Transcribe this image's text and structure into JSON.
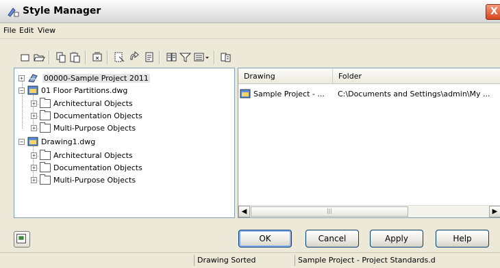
{
  "window": {
    "title": "Style Manager",
    "close_glyph": "X"
  },
  "menu": [
    "File",
    "Edit",
    "View"
  ],
  "toolbar_icons": [
    "new-icon",
    "open-icon",
    "copy-icon",
    "paste-icon",
    "purge-icon",
    "edit-style-icon",
    "rename-icon",
    "properties-icon",
    "toggle-view-icon",
    "filter-icon",
    "view-options-icon",
    "sort-icon"
  ],
  "tree": {
    "root": "00000-Sample Project 2011",
    "drawings": [
      {
        "name": "01 Floor Partitions.dwg",
        "children": [
          "Architectural Objects",
          "Documentation Objects",
          "Multi-Purpose Objects"
        ]
      },
      {
        "name": "Drawing1.dwg",
        "children": [
          "Architectural Objects",
          "Documentation Objects",
          "Multi-Purpose Objects"
        ]
      }
    ]
  },
  "list": {
    "columns": [
      "Drawing",
      "Folder"
    ],
    "rows": [
      {
        "drawing": "Sample Project - ...",
        "folder": "C:\\Documents and Settings\\admin\\My ..."
      }
    ]
  },
  "buttons": {
    "ok": "OK",
    "cancel": "Cancel",
    "apply": "Apply",
    "help": "Help"
  },
  "status": {
    "cell1": "Drawing Sorted",
    "cell2": "Sample Project - Project Standards.d"
  },
  "colors": {
    "accent": "#003c74",
    "close": "#d8451f",
    "list_border": "#7f9db9"
  }
}
